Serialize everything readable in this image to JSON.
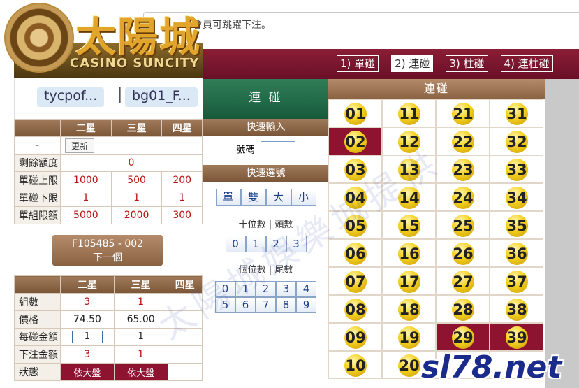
{
  "notice": "會員可跳躍下注。",
  "logo": {
    "title": "太陽城",
    "subtitle": "CASINO SUNCITY"
  },
  "tabs": [
    "1) 單碰",
    "2) 連碰",
    "3) 柱碰",
    "4) 連柱碰"
  ],
  "active_tab": 1,
  "account": {
    "user": "tycpof...",
    "separator": "|",
    "game": "bg01_F..."
  },
  "limits": {
    "columns": [
      "二星",
      "三星",
      "四星"
    ],
    "refresh_label": "更新",
    "dash": "-",
    "rows": [
      {
        "label": "剩餘額度",
        "values": [
          "0"
        ]
      },
      {
        "label": "單碰上限",
        "values": [
          "1000",
          "500",
          "200"
        ]
      },
      {
        "label": "單碰下限",
        "values": [
          "1",
          "1",
          "1"
        ]
      },
      {
        "label": "單組限額",
        "values": [
          "5000",
          "2000",
          "300"
        ]
      }
    ]
  },
  "next": {
    "code": "F105485 - 002",
    "label": "下一個"
  },
  "bet": {
    "columns": [
      "二星",
      "三星",
      "四星"
    ],
    "groups_label": "組數",
    "groups": [
      "3",
      "1"
    ],
    "price_label": "價格",
    "price": [
      "74.50",
      "65.00"
    ],
    "per_label": "每碰金額",
    "per": [
      "1",
      "1"
    ],
    "total_label": "下注金額",
    "total": [
      "3",
      "1"
    ],
    "status_label": "狀態",
    "status": [
      "依大盤",
      "依大盤"
    ]
  },
  "mid": {
    "title": "連 碰",
    "quick_input": "快速輸入",
    "code_label": "號碼",
    "quick_select": "快速選號",
    "parity_buttons": [
      "單",
      "雙",
      "大",
      "小"
    ],
    "tens_label": "十位數 | 頭數",
    "tens": [
      "0",
      "1",
      "2",
      "3"
    ],
    "units_label": "個位數 | 尾數",
    "units": [
      "0",
      "1",
      "2",
      "3",
      "4",
      "5",
      "6",
      "7",
      "8",
      "9"
    ]
  },
  "balls": {
    "header": "連碰",
    "rows": [
      [
        "01",
        "11",
        "21",
        "31"
      ],
      [
        "02",
        "12",
        "22",
        "32"
      ],
      [
        "03",
        "13",
        "23",
        "33"
      ],
      [
        "04",
        "14",
        "24",
        "34"
      ],
      [
        "05",
        "15",
        "25",
        "35"
      ],
      [
        "06",
        "16",
        "26",
        "36"
      ],
      [
        "07",
        "17",
        "27",
        "37"
      ],
      [
        "08",
        "18",
        "28",
        "38"
      ],
      [
        "09",
        "19",
        "29",
        "39"
      ],
      [
        "10",
        "20",
        "",
        ""
      ]
    ],
    "selected": [
      "02",
      "29",
      "39"
    ]
  },
  "watermark": "太陽城娛樂城提供",
  "site": "sl78.net"
}
